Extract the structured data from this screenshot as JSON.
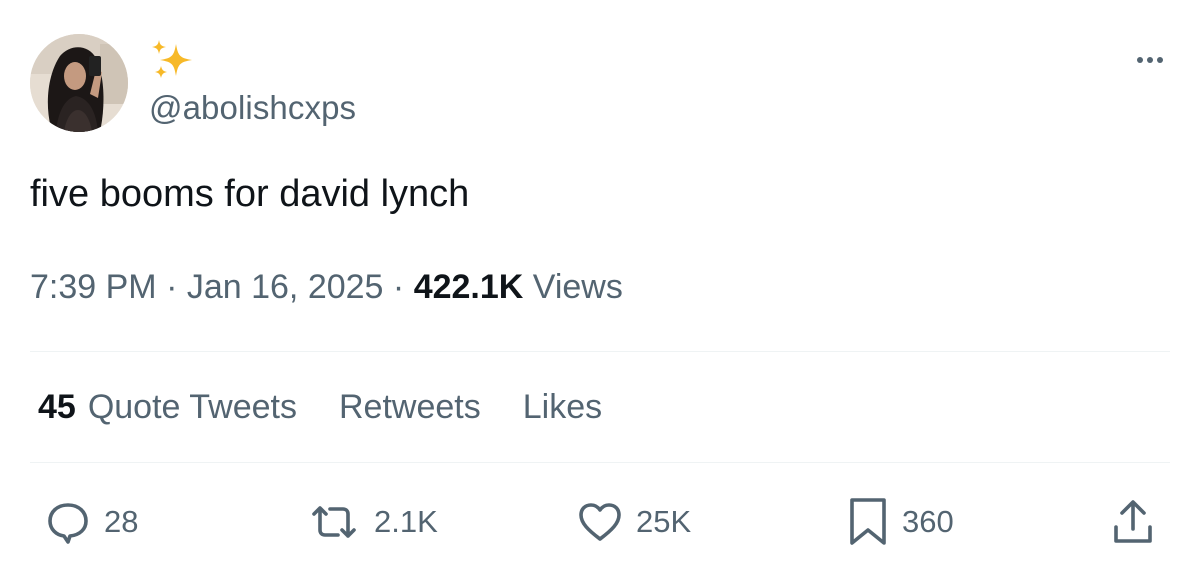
{
  "user": {
    "handle": "@abolishcxps",
    "display_name_icon": "sparkles-emoji",
    "avatar": "profile-photo"
  },
  "tweet": {
    "text": "five booms for david lynch",
    "time": "7:39 PM",
    "separator": " · ",
    "date": "Jan 16, 2025",
    "views_count": "422.1K",
    "views_label": " Views"
  },
  "stats": {
    "quote_count": "45",
    "quote_label": "Quote Tweets",
    "retweets_label": "Retweets",
    "likes_label": "Likes"
  },
  "actions": {
    "replies": "28",
    "retweets": "2.1K",
    "likes": "25K",
    "bookmarks": "360"
  },
  "colors": {
    "text_primary": "#0f1419",
    "text_secondary": "#536471",
    "divider": "#eff3f4",
    "sparkle": "#f7b928"
  }
}
